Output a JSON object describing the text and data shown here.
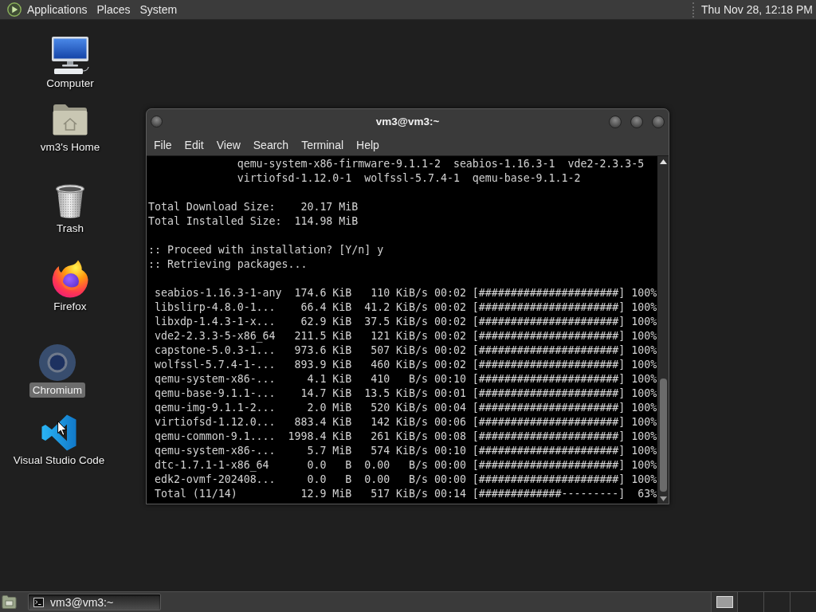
{
  "top_panel": {
    "menus": [
      "Applications",
      "Places",
      "System"
    ],
    "clock": "Thu Nov 28, 12:18 PM"
  },
  "desktop": {
    "icons": [
      {
        "kind": "monitor",
        "label": "Computer",
        "selected": false
      },
      {
        "kind": "folder",
        "label": "vm3's Home",
        "selected": false
      },
      {
        "kind": "bin",
        "label": "Trash",
        "selected": false
      },
      {
        "kind": "flame",
        "label": "Firefox",
        "selected": false
      },
      {
        "kind": "ring",
        "label": "Chromium",
        "selected": true
      },
      {
        "kind": "ribbon",
        "label": "Visual Studio Code",
        "selected": false
      }
    ]
  },
  "terminal_window": {
    "title": "vm3@vm3:~",
    "menus": [
      "File",
      "Edit",
      "View",
      "Search",
      "Terminal",
      "Help"
    ],
    "blocks": [
      [
        "              qemu-system-x86-firmware-9.1.1-2  seabios-1.16.3-1  vde2-2.3.3-5",
        "              virtiofsd-1.12.0-1  wolfssl-5.7.4-1  qemu-base-9.1.1-2"
      ],
      [
        "Total Download Size:    20.17 MiB",
        "Total Installed Size:  114.98 MiB"
      ],
      [
        ":: Proceed with installation? [Y/n] y",
        ":: Retrieving packages..."
      ],
      [
        " seabios-1.16.3-1-any  174.6 KiB   110 KiB/s 00:02 [######################] 100%",
        " libslirp-4.8.0-1...    66.4 KiB  41.2 KiB/s 00:02 [######################] 100%",
        " libxdp-1.4.3-1-x...    62.9 KiB  37.5 KiB/s 00:02 [######################] 100%",
        " vde2-2.3.3-5-x86_64   211.5 KiB   121 KiB/s 00:02 [######################] 100%",
        " capstone-5.0.3-1...   973.6 KiB   507 KiB/s 00:02 [######################] 100%",
        " wolfssl-5.7.4-1-...   893.9 KiB   460 KiB/s 00:02 [######################] 100%",
        " qemu-system-x86-...     4.1 KiB   410   B/s 00:10 [######################] 100%",
        " qemu-base-9.1.1-...    14.7 KiB  13.5 KiB/s 00:01 [######################] 100%",
        " qemu-img-9.1.1-2...     2.0 MiB   520 KiB/s 00:04 [######################] 100%",
        " virtiofsd-1.12.0...   883.4 KiB   142 KiB/s 00:06 [######################] 100%",
        " qemu-common-9.1....  1998.4 KiB   261 KiB/s 00:08 [######################] 100%",
        " qemu-system-x86-...     5.7 MiB   574 KiB/s 00:10 [######################] 100%",
        " dtc-1.7.1-1-x86_64      0.0   B  0.00   B/s 00:00 [######################] 100%",
        " edk2-ovmf-202408...     0.0   B  0.00   B/s 00:00 [######################] 100%",
        " Total (11/14)          12.9 MiB   517 KiB/s 00:14 [#############---------]  63%"
      ]
    ]
  },
  "bottom_panel": {
    "tasks": [
      {
        "label": "vm3@vm3:~",
        "selected": true
      }
    ],
    "workspaces": [
      {
        "selected": true
      },
      {
        "selected": false
      },
      {
        "selected": false
      },
      {
        "selected": false
      }
    ]
  }
}
